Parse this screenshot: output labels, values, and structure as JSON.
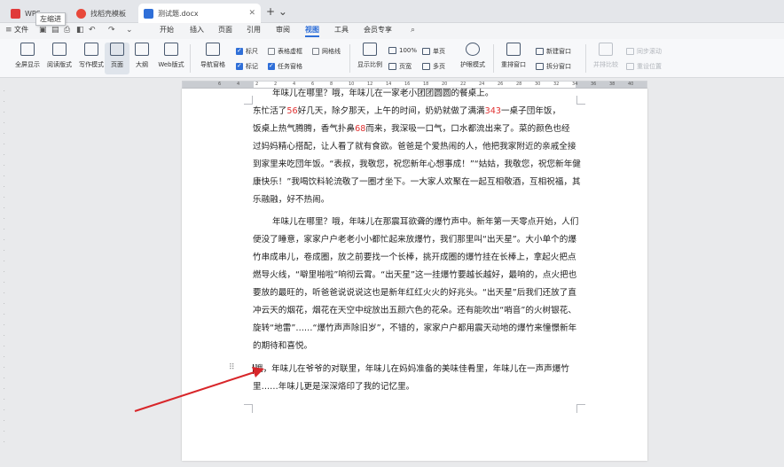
{
  "tabs": [
    {
      "label": "WPS",
      "icon": "wps-logo-icon",
      "color": "#e03a3a",
      "active": false
    },
    {
      "label": "找稻壳模板",
      "icon": "docer-icon",
      "color": "#e8483a",
      "active": false
    },
    {
      "label": "测试题.docx",
      "icon": "word-doc-icon",
      "color": "#2f6fd8",
      "active": true
    }
  ],
  "tooltip": "左缩进",
  "menu": {
    "file": "文件",
    "items": [
      "开始",
      "插入",
      "页面",
      "引用",
      "审阅",
      "视图",
      "工具",
      "会员专享"
    ],
    "active": "视图"
  },
  "ribbon": {
    "big_buttons": [
      {
        "label": "全屏显示",
        "icon": "fullscreen-icon"
      },
      {
        "label": "阅读版式",
        "icon": "read-mode-icon"
      },
      {
        "label": "写作模式",
        "icon": "write-mode-icon"
      },
      {
        "label": "页面",
        "icon": "page-view-icon",
        "selected": true
      },
      {
        "label": "大纲",
        "icon": "outline-icon"
      },
      {
        "label": "Web版式",
        "icon": "web-layout-icon"
      },
      {
        "label": "导航窗格",
        "icon": "nav-pane-icon"
      }
    ],
    "checks": [
      {
        "label": "标尺",
        "on": true
      },
      {
        "label": "表格虚框",
        "on": false
      },
      {
        "label": "网格线",
        "on": false
      },
      {
        "label": "标记",
        "on": true
      },
      {
        "label": "任务窗格",
        "on": true
      }
    ],
    "zoom_button": "显示比例",
    "zoom_value": "100%",
    "single_page": "单页",
    "page_width": "页宽",
    "multi_page": "多页",
    "eye_mode": "护眼模式",
    "arrange_all": "重排窗口",
    "new_window": "新建窗口",
    "split_window": "拆分窗口",
    "side_by_side": "并排比较",
    "sync_scroll": "同步滚动",
    "reset_position": "重设位置"
  },
  "ruler_ticks": [
    "6",
    "4",
    "2",
    "2",
    "4",
    "6",
    "8",
    "10",
    "12",
    "14",
    "16",
    "18",
    "20",
    "22",
    "24",
    "26",
    "28",
    "30",
    "32",
    "34",
    "36",
    "38",
    "40"
  ],
  "document": {
    "para1_lead": "年味儿在哪里？哦，年味儿在一家老小团团圆圆的餐桌上。",
    "para1_line2_a": "东忙活了",
    "para1_num1": "56",
    "para1_line2_b": "好几天，除夕那天，上午的时间，奶奶就做了满满",
    "para1_num2": "343",
    "para1_line2_c": "一桌子団年饭，",
    "para1_line3_a": "饭桌上热气腾腾，香气扑鼻",
    "para1_num3": "68",
    "para1_line3_b": "而来，我深吸一口气，口水都流出来了。菜的颜色也经",
    "para1_rest": "过妈妈精心搭配，让人看了就有食欲。爸爸是个爱热闹的人，他把我家附近的亲戚全接到家里来吃団年饭。“表叔，我敬您，祝您新年心想事成！”“姑姑，我敬您，祝您新年健康快乐！”我喝饮料轮流敬了一圈才坐下。一大家人欢聚在一起互相敬酒，互相祝福，其乐融融，好不热闹。",
    "para2": "年味儿在哪里？哦，年味儿在那震耳欲聋的爆竹声中。新年第一天零点开始，人们便没了睡意，家家户户老老小小都忙起来放爆竹，我们那里叫“出天星”。大小单个的爆竹串成串儿，卷成圈，放之前要找一个长棒，挑开成圈的爆竹挂在长棒上，拿起火把点燃导火线，“噼里啪啦”响彻云霄。“出天星”这一挂爆竹要越长越好，最响的，点火把也要放的最旺的，听爸爸说说说这也是新年红红火火的好兆头。“出天星”后我们还放了直冲云天的烟花，烟花在天空中绽放出五颜六色的花朵。还有能吹出“哨音”的火树银花、旋转“地雷”……“爆竹声声除旧岁”，不错的，家家户户都用震天动地的爆竹来憧憬新年的期待和喜悦。",
    "para3": "哦，年味儿在爷爷的对联里，年味儿在妈妈准备的美味佳肴里，年味儿在一声声爆竹里……年味儿更是深深烙印了我的记忆里。"
  }
}
